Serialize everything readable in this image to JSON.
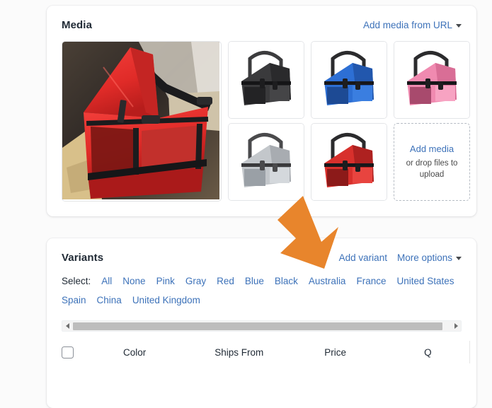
{
  "page": {
    "background_color": "#fbfbfb",
    "link_color": "#3d72b9",
    "text_color": "#212b36"
  },
  "media": {
    "title": "Media",
    "add_from_url_label": "Add media from URL",
    "hero": {
      "alt": "Red pet booster car seat installed on a car seat",
      "color_name": "Red",
      "main_color": "#e02b28"
    },
    "thumbnails": [
      {
        "color_name": "Black",
        "main_color": "#3a3a3c"
      },
      {
        "color_name": "Blue",
        "main_color": "#2d6fd4"
      },
      {
        "color_name": "Pink",
        "main_color": "#f08ab0"
      },
      {
        "color_name": "Gray",
        "main_color": "#b9bdc2"
      },
      {
        "color_name": "Red",
        "main_color": "#d8302c"
      }
    ],
    "dropzone": {
      "main_label": "Add media",
      "sub_label": "or drop files to upload"
    }
  },
  "variants": {
    "title": "Variants",
    "add_variant_label": "Add variant",
    "more_options_label": "More options",
    "select_label": "Select:",
    "select_links": [
      "All",
      "None",
      "Pink",
      "Gray",
      "Red",
      "Blue",
      "Black",
      "Australia",
      "France",
      "United States",
      "Spain",
      "China",
      "United Kingdom"
    ],
    "scrollbar": {
      "left_arrow": "◂",
      "right_arrow": "▸",
      "thumb_percent": 98
    },
    "table": {
      "select_all_checked": false,
      "columns": [
        "Color",
        "Ships From",
        "Price",
        "Q"
      ]
    }
  },
  "annotation": {
    "arrow_color": "#e8852c",
    "points_to": "Add variant"
  }
}
